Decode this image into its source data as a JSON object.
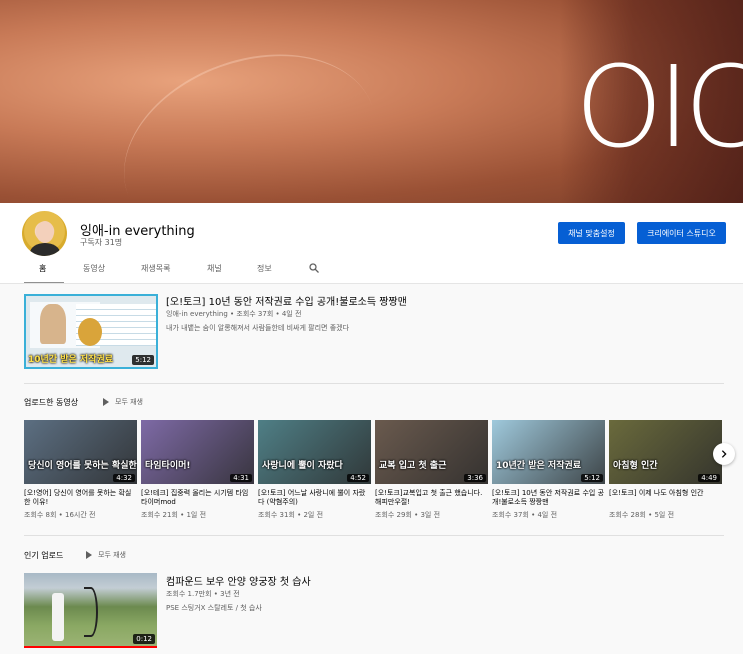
{
  "banner": {
    "text": "OIC"
  },
  "channel": {
    "name": "잉애-in everything",
    "subscribers": "구독자 31명",
    "customize_button": "채널 맞춤설정",
    "studio_button": "크리에이터 스튜디오"
  },
  "tabs": [
    {
      "label": "홈"
    },
    {
      "label": "동영상"
    },
    {
      "label": "재생목록"
    },
    {
      "label": "채널"
    },
    {
      "label": "정보"
    }
  ],
  "featured": {
    "title": "[오!토크] 10년 동안 저작권료 수입 공개!불로소득 짱짱맨",
    "meta": "잉애-in everything • 조회수 37회 • 4일 전",
    "description": "내가 내뱉는 숨이 알롱해져서 사람들한테 비싸게 팔리면 좋겠다",
    "duration": "5:12",
    "thumb_caption": "10년간 받은 저작권료"
  },
  "uploads": {
    "title": "업로드한 동영상",
    "play_all": "모두 재생",
    "videos": [
      {
        "title": "[오!영어] 당신이 영어를 못하는 확실한 이유!",
        "meta": "조회수 8회 • 16시간 전",
        "duration": "4:32",
        "caption": "당신이 영어를 못하는 확실한 이유",
        "bg": "#5c6f82",
        "progress": 0.0
      },
      {
        "title": "[오!테크] 집중력 올리는 시기템 타임타이머mod",
        "meta": "조회수 21회 • 1일 전",
        "duration": "4:31",
        "caption": "타임타이머!",
        "bg": "#7e6aa6",
        "progress": 0.0
      },
      {
        "title": "[오!토크] 어느날 사랑니에 뿔이 자랐다 (약혐주의)",
        "meta": "조회수 31회 • 2일 전",
        "duration": "4:52",
        "caption": "사랑니에 뿔이 자랐다",
        "bg": "#4f7f86",
        "progress": 0.0
      },
      {
        "title": "[오!토크]교복입고 첫 출근 했습니다. 해피만우절!",
        "meta": "조회수 29회 • 3일 전",
        "duration": "3:36",
        "caption": "교복 입고 첫 출근",
        "bg": "#6a5a4e",
        "progress": 0.0
      },
      {
        "title": "[오!토크] 10년 동안 저작권료 수입 공개!불로소득 짱짱맨",
        "meta": "조회수 37회 • 4일 전",
        "duration": "5:12",
        "caption": "10년간 받은 저작권료",
        "bg": "#9fc9dc",
        "progress": 0.0
      },
      {
        "title": "[오!토크] 이제 나도 아침형 인간",
        "meta": "조회수 28회 • 5일 전",
        "duration": "4:49",
        "caption": "아침형 인간",
        "bg": "#6a6a3c",
        "progress": 0.0
      }
    ]
  },
  "popular": {
    "title": "인기 업로드",
    "play_all": "모두 재생",
    "video": {
      "title": "컴파운드 보우 안양 양궁장 첫 습사",
      "meta": "조회수 1.7만회 • 3년 전",
      "description": "PSE 스팅거X 스탈레토 / 첫 습사",
      "duration": "0:12",
      "progress": 1.0
    }
  }
}
